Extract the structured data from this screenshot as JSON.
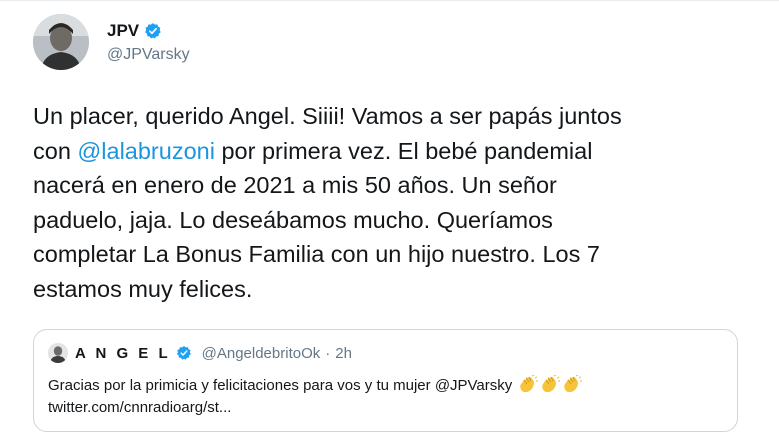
{
  "tweet": {
    "display_name": "JPV",
    "handle": "@JPVarsky",
    "avatar_icon": "user-avatar-photo",
    "verified_icon": "verified-badge-icon",
    "text_part1": "Un placer, querido Angel. Siiii! Vamos a ser papás juntos\ncon ",
    "mention": "@lalabruzoni",
    "text_part2": " por primera vez. El bebé pandemial\nnacerá en enero de 2021 a mis 50 años. Un señor\npaduelo, jaja. Lo deseábamos mucho. Queríamos\ncompletar La Bonus Familia con un hijo nuestro. Los 7\nestamos muy felices."
  },
  "quote": {
    "display_name": "A N G E L",
    "handle": "@AngeldebritoOk",
    "separator": "·",
    "time": "2h",
    "text": "Gracias por la primicia y felicitaciones para vos y tu mujer ",
    "mention": "@JPVarsky",
    "emoji": "clapping-hands-icon",
    "link": "twitter.com/cnnradioarg/st..."
  },
  "colors": {
    "accent": "#1b95e0",
    "verified": "#1da1f2",
    "muted": "#657786",
    "border": "#ccd6dd"
  }
}
